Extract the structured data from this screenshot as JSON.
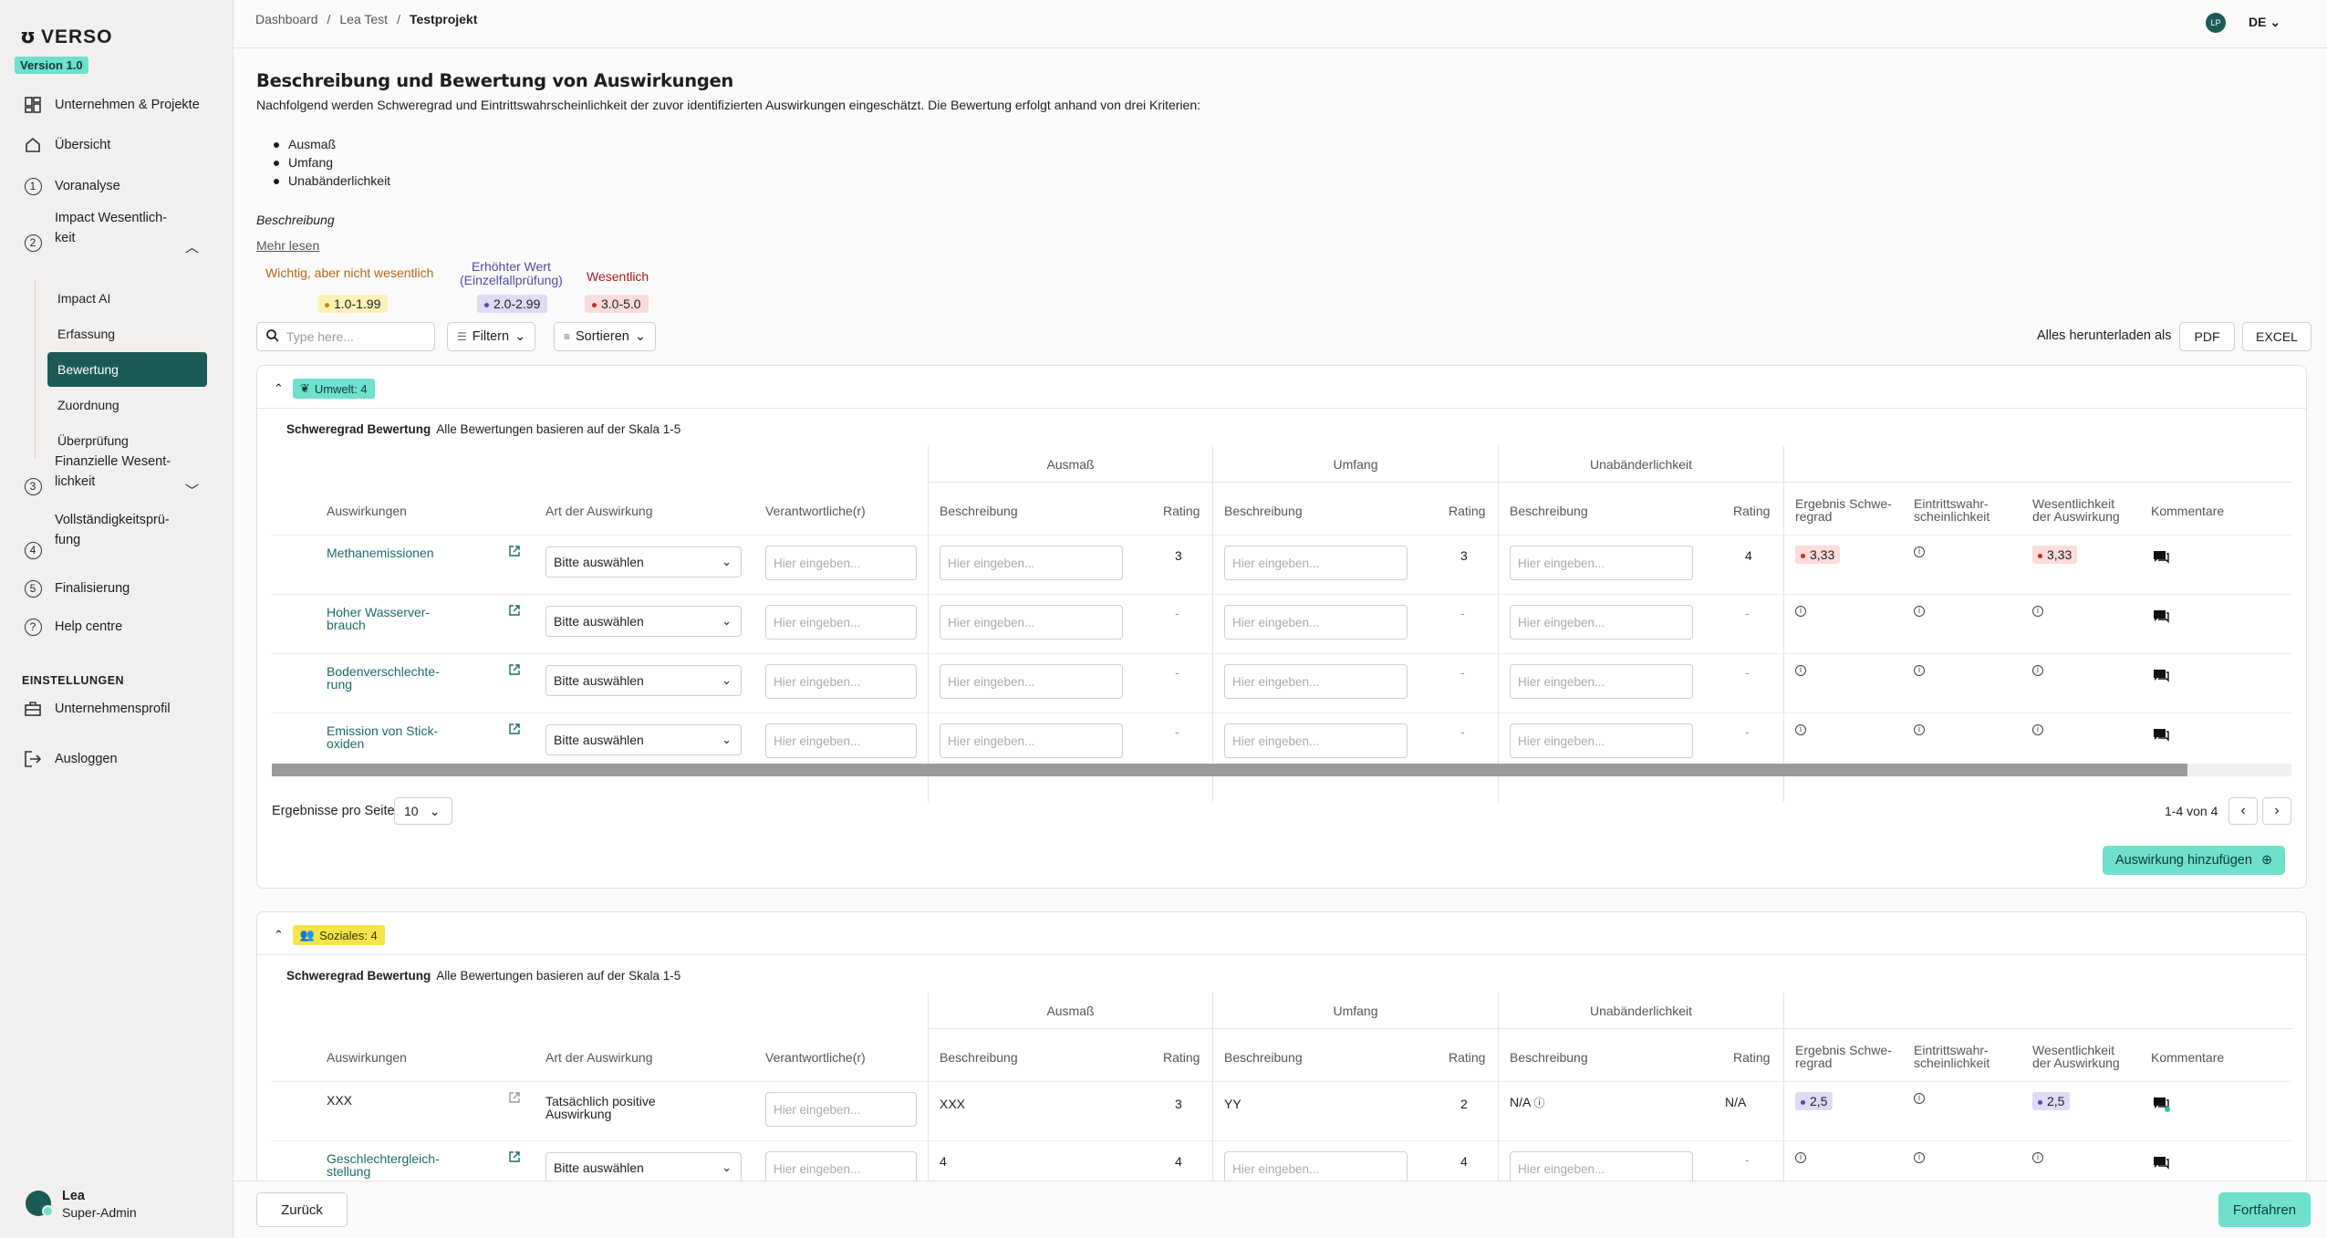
{
  "brand": {
    "name": "VERSO",
    "version": "Version 1.0"
  },
  "sidebar": {
    "items": [
      {
        "label": "Unternehmen & Projekte",
        "icon": "dashboard-icon"
      },
      {
        "label": "Übersicht",
        "icon": "home-icon"
      },
      {
        "label": "Voranalyse",
        "num": "1"
      },
      {
        "label": "Impact Wesentlich-",
        "label2": "keit",
        "num": "2"
      },
      {
        "label": "Finanzielle Wesent-",
        "label2": "lichkeit",
        "num": "3"
      },
      {
        "label": "Vollständigkeitsprü-",
        "label2": "fung",
        "num": "4"
      },
      {
        "label": "Finalisierung",
        "num": "5"
      },
      {
        "label": "Help centre",
        "icon": "help-icon"
      },
      {
        "label": "Unternehmensprofil",
        "icon": "briefcase-icon"
      },
      {
        "label": "Ausloggen",
        "icon": "logout-icon"
      }
    ],
    "subitems": [
      "Impact AI",
      "Erfassung",
      "Bewertung",
      "Zuordnung",
      "Überprüfung"
    ],
    "section": "EINSTELLUNGEN",
    "user": {
      "name": "Lea",
      "role": "Super-Admin"
    }
  },
  "topbar": {
    "crumbs": [
      "Dashboard",
      "Lea Test",
      "Testprojekt"
    ],
    "initials": "LP",
    "lang": "DE"
  },
  "page": {
    "title": "Beschreibung und Bewertung von Auswirkungen",
    "intro": "Nachfolgend werden Schweregrad und Eintrittswahrscheinlichkeit der zuvor identifizierten Auswirkungen eingeschätzt. Die Bewertung erfolgt anhand von drei Kriterien:",
    "criteria": [
      "Ausmaß",
      "Umfang",
      "Unabänderlichkeit"
    ],
    "beschreibung": "Beschreibung",
    "more": "Mehr lesen",
    "legend": [
      {
        "label": "Wichtig, aber nicht wesentlich",
        "range": "1.0-1.99",
        "color": "#b8650f",
        "bg": "#fdf1b8",
        "dot": "#c08a00"
      },
      {
        "label": "Erhöhter Wert",
        "label2": "(Einzelfallprüfung)",
        "range": "2.0-2.99",
        "color": "#4e4ca8",
        "bg": "#dcdcf7",
        "dot": "#4e4ca8"
      },
      {
        "label": "Wesentlich",
        "range": "3.0-5.0",
        "color": "#a3201e",
        "bg": "#fbdcdb",
        "dot": "#c52a26"
      }
    ]
  },
  "toolbar": {
    "search_placeholder": "Type here...",
    "filter": "Filtern",
    "sort": "Sortieren",
    "download_label": "Alles herunterladen als",
    "pdf": "PDF",
    "excel": "EXCEL"
  },
  "table_headers": {
    "severity_title": "Schweregrad Bewertung",
    "severity_note": "Alle Bewertungen basieren auf der Skala 1-5",
    "groups": [
      "Ausmaß",
      "Umfang",
      "Unabänderlichkeit"
    ],
    "impacts": "Auswirkungen",
    "art": "Art der Auswirkung",
    "resp": "Verantwortliche(r)",
    "desc": "Beschreibung",
    "rating": "Rating",
    "result1": "Ergebnis Schwe-",
    "result2": "regrad",
    "prob1": "Eintrittswahr-",
    "prob2": "scheinlichkeit",
    "mat1": "Wesentlichkeit",
    "mat2": "der Auswirkung",
    "comments": "Kommentare"
  },
  "common": {
    "select": "Bitte auswählen",
    "placeholder": "Hier eingeben...",
    "dash": "-"
  },
  "categories": [
    {
      "badge": "Umwelt: 4",
      "rows": [
        {
          "name1": "Methanemissionen",
          "name2": "",
          "r1": "3",
          "r2": "3",
          "r3": "4",
          "result": "3,33",
          "mat": "3,33"
        },
        {
          "name1": "Hoher Wasserver-",
          "name2": "brauch",
          "r1": "-",
          "r2": "-",
          "r3": "-"
        },
        {
          "name1": "Bodenverschlechte-",
          "name2": "rung",
          "r1": "-",
          "r2": "-",
          "r3": "-"
        },
        {
          "name1": "Emission von Stick-",
          "name2": "oxiden",
          "r1": "-",
          "r2": "-",
          "r3": "-"
        }
      ],
      "per_page_label": "Ergebnisse pro Seite",
      "per_page": "10",
      "pager": "1-4 von 4",
      "add": "Auswirkung hinzufügen"
    },
    {
      "badge": "Soziales: 4",
      "rows": [
        {
          "name1": "XXX",
          "name2": "",
          "art1": "Tatsächlich positive",
          "art2": "Auswirkung",
          "d1": "XXX",
          "r1": "3",
          "d2": "YY",
          "r2": "2",
          "d3": "N/A",
          "r3": "N/A",
          "result": "2,5",
          "mat": "2,5"
        },
        {
          "name1": "Geschlechtergleich-",
          "name2": "stellung",
          "d1": "4",
          "r1": "4",
          "r2": "4",
          "r3": "-"
        }
      ]
    }
  ],
  "footer": {
    "back": "Zurück",
    "next": "Fortfahren"
  }
}
